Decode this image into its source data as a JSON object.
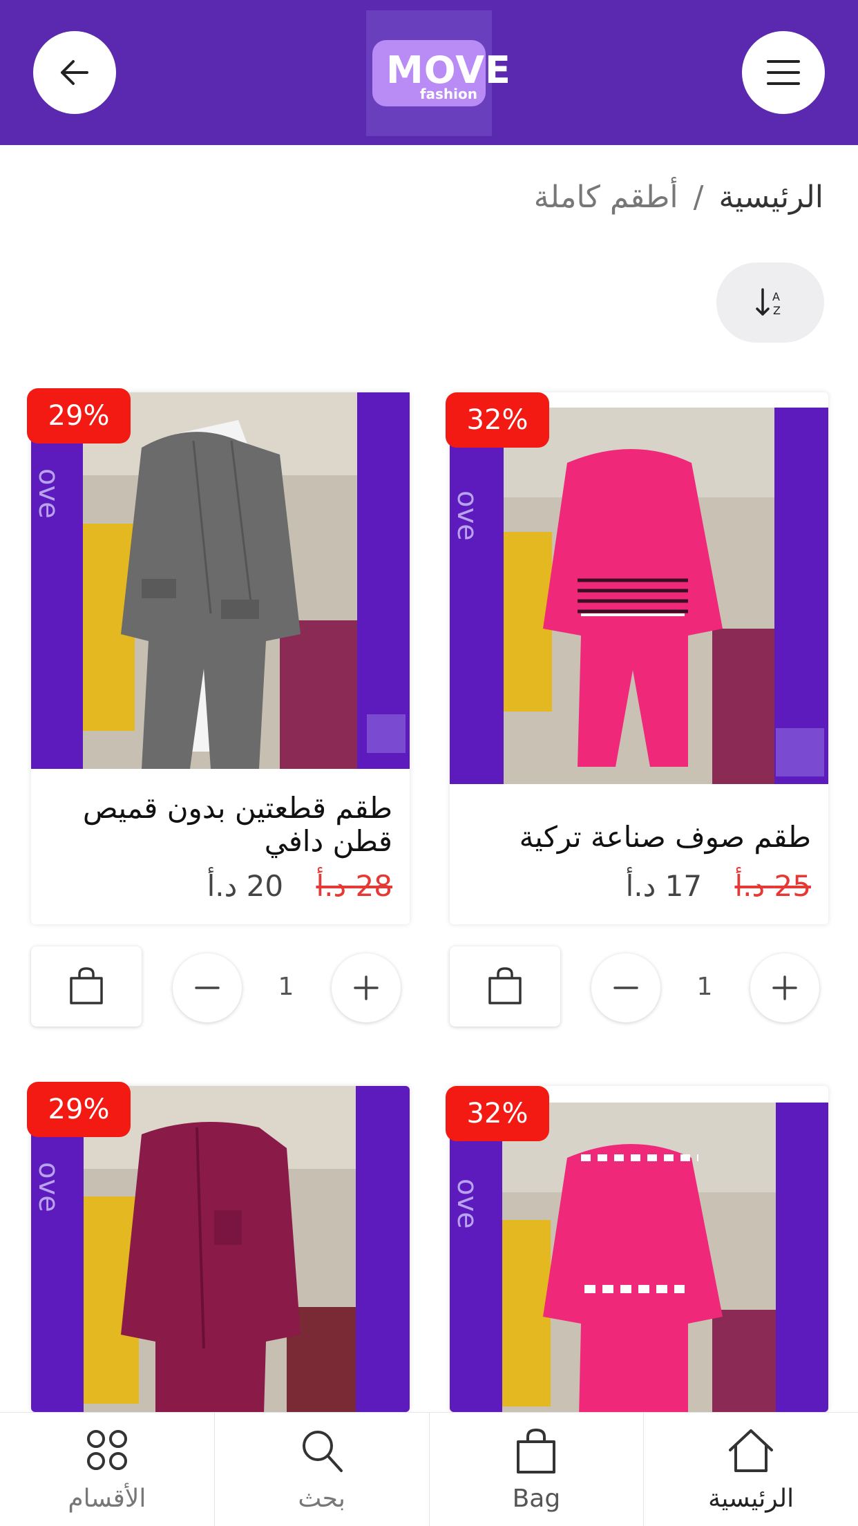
{
  "header": {
    "back_icon": "arrow-left-icon",
    "menu_icon": "hamburger-menu-icon",
    "logo_text": "MOVE",
    "logo_sub": "fashion",
    "color": "#5b28b0"
  },
  "breadcrumb": {
    "home": "الرئيسية",
    "separator": "/",
    "current": "أطقم كاملة"
  },
  "sort": {
    "icon": "sort-az-icon"
  },
  "products": [
    {
      "title": "طقم صوف صناعة تركية",
      "discount": "32%",
      "old_price": "25 د.أ",
      "new_price": "17 د.أ",
      "quantity": "1",
      "garment_color": "#f0287a"
    },
    {
      "title": "طقم قطعتين بدون قميص قطن دافي",
      "discount": "29%",
      "old_price": "28 د.أ",
      "new_price": "20 د.أ",
      "quantity": "1",
      "garment_color": "#6b6b6b"
    },
    {
      "discount": "32%",
      "garment_color": "#f0287a"
    },
    {
      "discount": "29%",
      "garment_color": "#8a1a48"
    }
  ],
  "bottom_nav": [
    {
      "label": "الرئيسية",
      "icon": "home-icon"
    },
    {
      "label": "Bag",
      "icon": "bag-icon"
    },
    {
      "label": "بحث",
      "icon": "search-icon"
    },
    {
      "label": "الأقسام",
      "icon": "categories-grid-icon"
    }
  ],
  "colors": {
    "primary": "#5b28b0",
    "badge": "#f41a14",
    "old_price": "#e53935"
  }
}
